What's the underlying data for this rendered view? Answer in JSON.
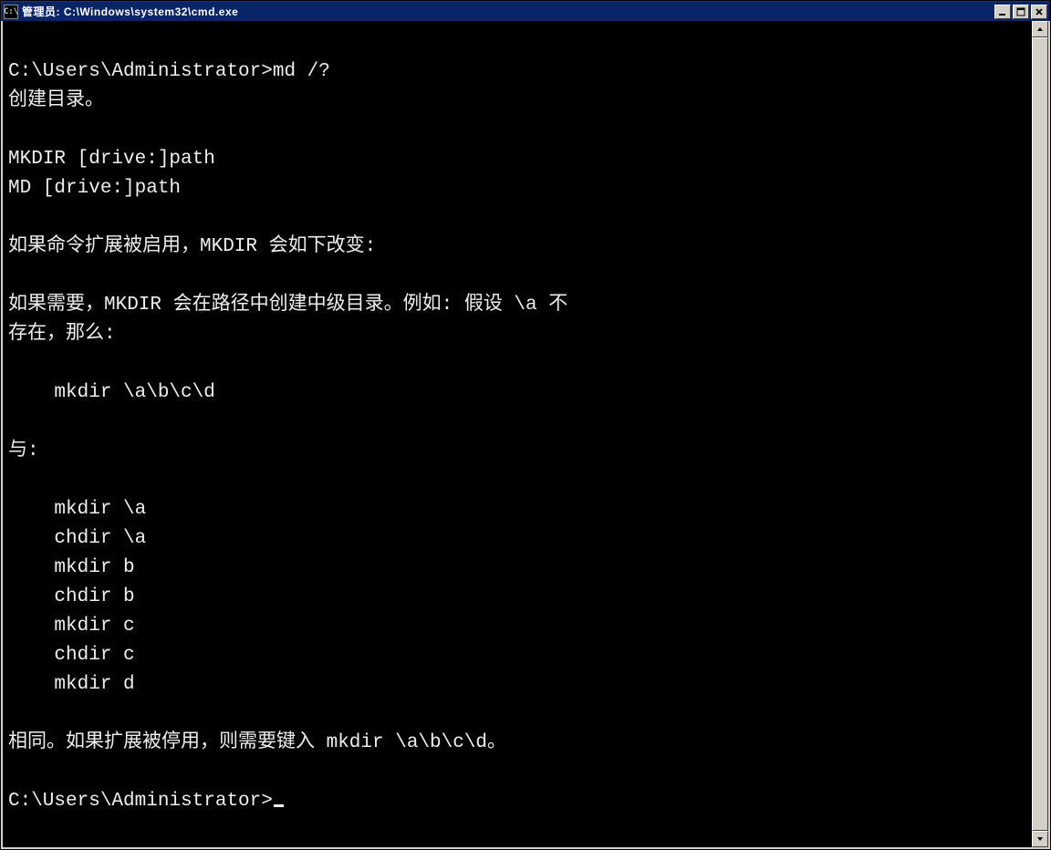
{
  "window": {
    "title": "管理员: C:\\Windows\\system32\\cmd.exe",
    "icon_label": "C:\\"
  },
  "terminal": {
    "prompt1": "C:\\Users\\Administrator>",
    "command1": "md /?",
    "output_lines": [
      "创建目录。",
      "",
      "MKDIR [drive:]path",
      "MD [drive:]path",
      "",
      "如果命令扩展被启用，MKDIR 会如下改变:",
      "",
      "如果需要，MKDIR 会在路径中创建中级目录。例如: 假设 \\a 不",
      "存在，那么:",
      "",
      "    mkdir \\a\\b\\c\\d",
      "",
      "与:",
      "",
      "    mkdir \\a",
      "    chdir \\a",
      "    mkdir b",
      "    chdir b",
      "    mkdir c",
      "    chdir c",
      "    mkdir d",
      "",
      "相同。如果扩展被停用，则需要键入 mkdir \\a\\b\\c\\d。",
      ""
    ],
    "prompt2": "C:\\Users\\Administrator>"
  }
}
